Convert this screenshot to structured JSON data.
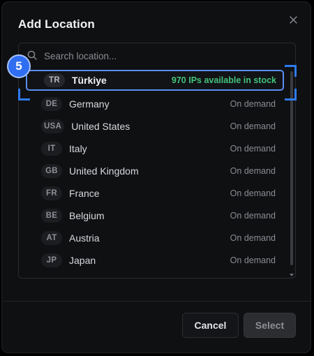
{
  "dialog": {
    "title": "Add Location",
    "close_label": "×"
  },
  "search": {
    "placeholder": "Search location...",
    "value": ""
  },
  "locations": [
    {
      "code": "TR",
      "name": "Türkiye",
      "status": "970 IPs available in stock",
      "selected": true
    },
    {
      "code": "DE",
      "name": "Germany",
      "status": "On demand"
    },
    {
      "code": "USA",
      "name": "United States",
      "status": "On demand"
    },
    {
      "code": "IT",
      "name": "Italy",
      "status": "On demand"
    },
    {
      "code": "GB",
      "name": "United Kingdom",
      "status": "On demand"
    },
    {
      "code": "FR",
      "name": "France",
      "status": "On demand"
    },
    {
      "code": "BE",
      "name": "Belgium",
      "status": "On demand"
    },
    {
      "code": "AT",
      "name": "Austria",
      "status": "On demand"
    },
    {
      "code": "JP",
      "name": "Japan",
      "status": "On demand"
    }
  ],
  "step_badge": "5",
  "footer": {
    "cancel_label": "Cancel",
    "select_label": "Select"
  },
  "colors": {
    "accent": "#2f6ef0",
    "in_stock": "#43c27d",
    "background": "#0f1012"
  },
  "icons": {
    "search": "search-icon",
    "close": "close-icon",
    "scroll_down": "chevron-down-icon"
  }
}
